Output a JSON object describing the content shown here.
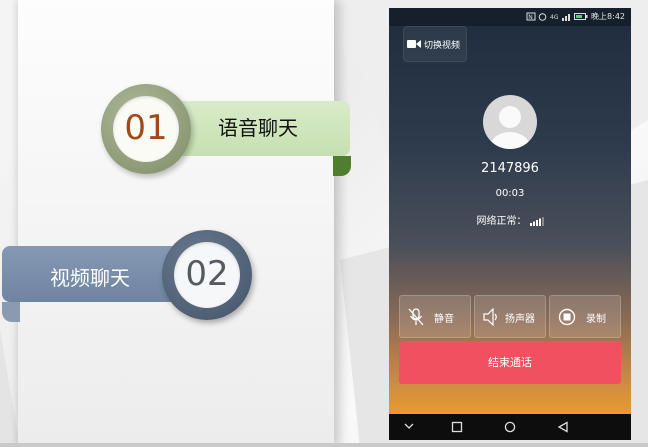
{
  "steps": [
    {
      "number": "01",
      "label": "语音聊天",
      "colors": {
        "ribbon": "#c6e0b1",
        "ring": "#8d9a76",
        "number": "#a04a1c"
      }
    },
    {
      "number": "02",
      "label": "视频聊天",
      "colors": {
        "ribbon": "#7b8ea9",
        "ring": "#4f5f74",
        "number": "#555a60"
      }
    }
  ],
  "phone": {
    "status_bar": {
      "time": "晚上8:42"
    },
    "switch_video": {
      "label": "切换视频",
      "icon": "video-camera-icon"
    },
    "caller": {
      "number": "2147896",
      "avatar_icon": "default-avatar-icon"
    },
    "call_timer": "00:03",
    "network_status": "网络正常：",
    "controls": [
      {
        "label": "静音",
        "icon": "microphone-off-icon"
      },
      {
        "label": "扬声器",
        "icon": "speaker-icon"
      },
      {
        "label": "录制",
        "icon": "record-icon"
      }
    ],
    "end_call": {
      "label": "结束通话",
      "color": "#f05060"
    },
    "nav_icons": [
      "chevron-down-icon",
      "home-square-icon",
      "circle-icon",
      "back-triangle-icon"
    ]
  }
}
